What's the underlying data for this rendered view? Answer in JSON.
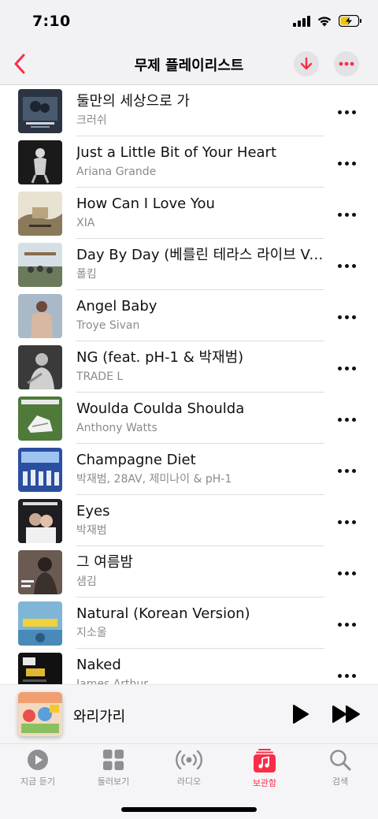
{
  "status_bar": {
    "time": "7:10"
  },
  "header": {
    "title": "무제 플레이리스트"
  },
  "colors": {
    "accent": "#fa2d48"
  },
  "songs": [
    {
      "title": "둘만의 세상으로 가",
      "artist": "크러쉬"
    },
    {
      "title": "Just a Little Bit of Your Heart",
      "artist": "Ariana Grande"
    },
    {
      "title": "How Can I Love You",
      "artist": "XIA"
    },
    {
      "title": "Day By Day (베를린 테라스 라이브 Ver.)",
      "artist": "폴킴"
    },
    {
      "title": "Angel Baby",
      "artist": "Troye Sivan"
    },
    {
      "title": "NG (feat. pH-1 & 박재범)",
      "artist": "TRADE L"
    },
    {
      "title": "Woulda Coulda Shoulda",
      "artist": "Anthony Watts"
    },
    {
      "title": "Champagne Diet",
      "artist": "박재범, 28AV, 제미나이 & pH-1"
    },
    {
      "title": "Eyes",
      "artist": "박재범"
    },
    {
      "title": "그 여름밤",
      "artist": "샘김"
    },
    {
      "title": "Natural (Korean Version)",
      "artist": "지소울"
    },
    {
      "title": "Naked",
      "artist": "James Arthur"
    }
  ],
  "now_playing": {
    "title": "와리가리"
  },
  "tabs": [
    {
      "label": "지금 듣기",
      "icon": "play-circle-icon"
    },
    {
      "label": "둘러보기",
      "icon": "grid-icon"
    },
    {
      "label": "라디오",
      "icon": "radio-icon"
    },
    {
      "label": "보관함",
      "icon": "music-library-icon",
      "active": true
    },
    {
      "label": "검색",
      "icon": "search-icon"
    }
  ]
}
